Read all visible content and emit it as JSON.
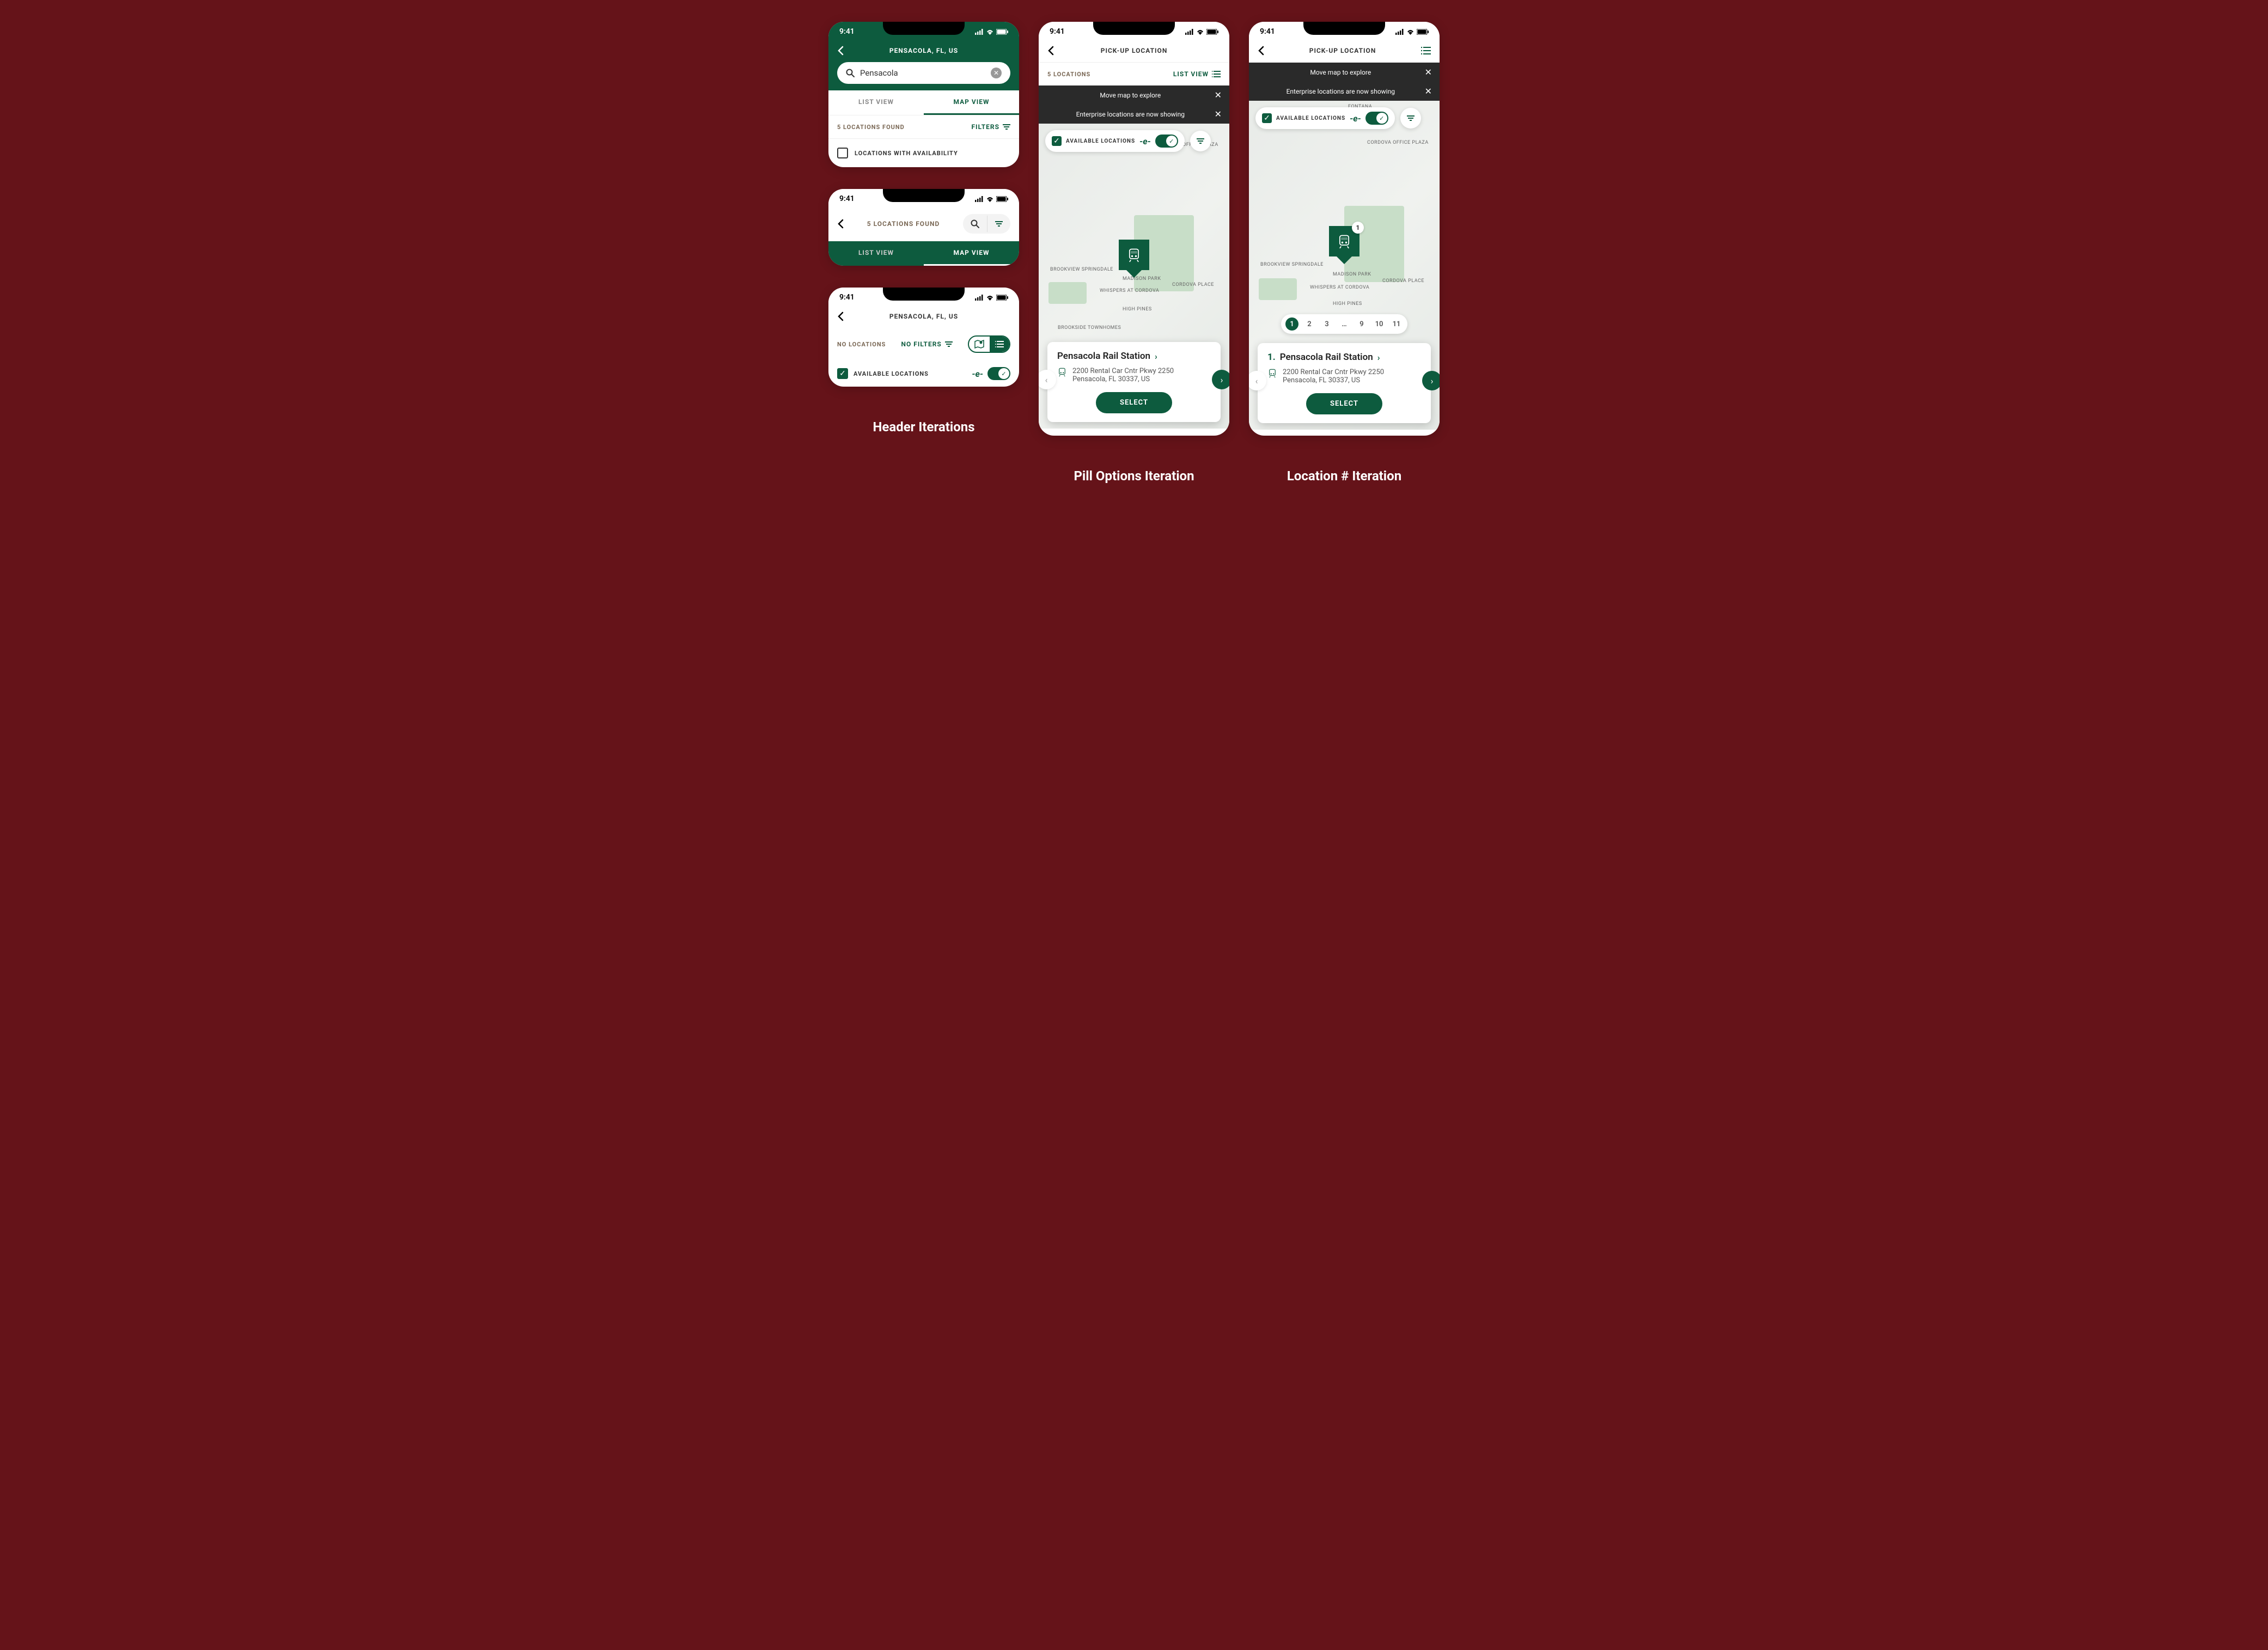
{
  "status": {
    "time": "9:41"
  },
  "captions": {
    "left": "Header Iterations",
    "mid": "Pill Options Iteration",
    "right": "Location # Iteration"
  },
  "h1": {
    "title": "PENSACOLA, FL, US",
    "search_value": "Pensacola",
    "tab_list": "LIST VIEW",
    "tab_map": "MAP VIEW",
    "count": "5 LOCATIONS FOUND",
    "filters": "FILTERS",
    "check_label": "LOCATIONS WITH AVAILABILITY"
  },
  "h2": {
    "count": "5 LOCATIONS FOUND",
    "tab_list": "LIST VIEW",
    "tab_map": "MAP VIEW"
  },
  "h3": {
    "title": "PENSACOLA, FL, US",
    "no_loc": "NO LOCATIONS",
    "no_filters": "NO FILTERS",
    "avail": "AVAILABLE LOCATIONS"
  },
  "map_screen": {
    "title": "PICK-UP LOCATION",
    "count": "5 LOCATIONS",
    "list_view": "LIST VIEW",
    "toast1": "Move map to explore",
    "toast2": "Enterprise locations are now showing",
    "avail": "AVAILABLE LOCATIONS",
    "card": {
      "name": "Pensacola Rail Station",
      "addr1": "2200 Rental Car Cntr Pkwy 2250",
      "addr2": "Pensacola, FL 30337, US",
      "select": "SELECT"
    },
    "pages": [
      "1",
      "2",
      "3",
      "…",
      "9",
      "10",
      "11"
    ],
    "card_num": "1."
  }
}
